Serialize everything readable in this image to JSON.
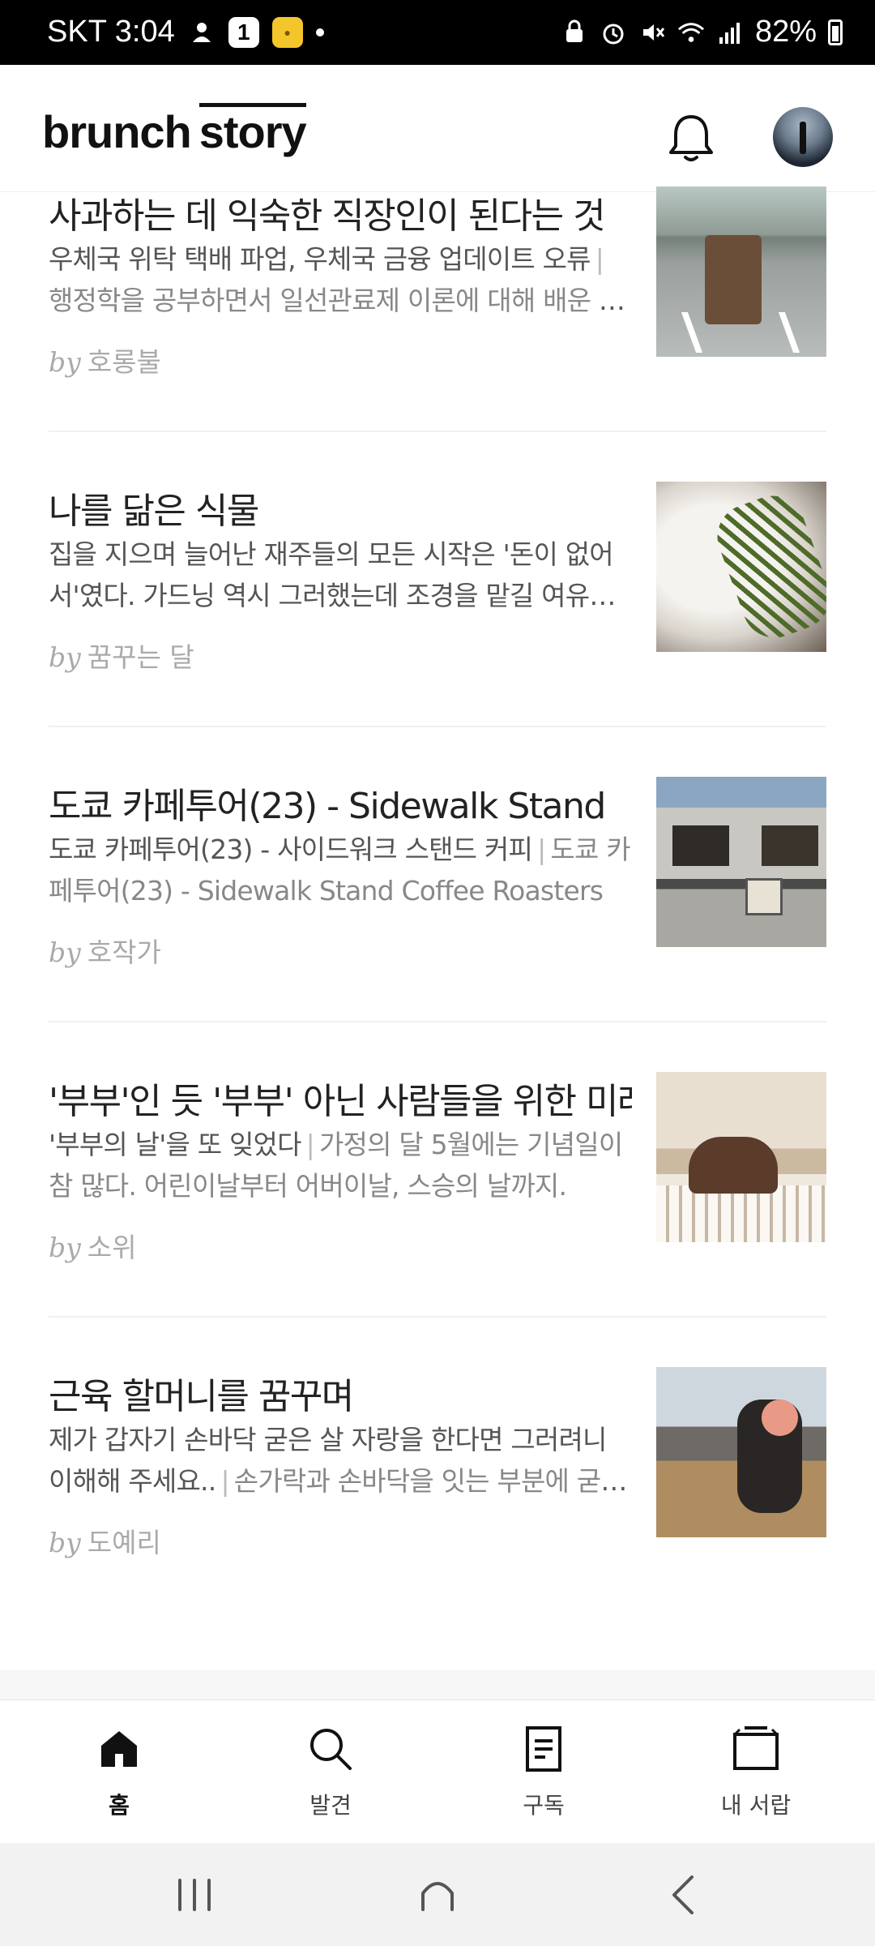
{
  "status_bar": {
    "carrier_time": "SKT 3:04",
    "badge_number": "1",
    "battery": "82%"
  },
  "header": {
    "logo_part1": "brunch",
    "logo_part2": "story"
  },
  "articles": [
    {
      "title": "사과하는 데 익숙한 직장인이 된다는 것",
      "desc": "우체국 위탁 택배 파업, 우체국 금융 업데이트 오류",
      "subdesc": "행정학을 공부하면서 일선관료제 이론에 대해 배운 적이 있다.",
      "by": "by",
      "author": "호롱불"
    },
    {
      "title": "나를 닮은 식물",
      "desc": "집을 지으며 늘어난 재주들의 모든 시작은 '돈이 없어서'였다. 가드닝 역시 그러했는데 조경을 맡길 여유가 없었다.",
      "subdesc": "",
      "by": "by",
      "author": "꿈꾸는 달"
    },
    {
      "title": "도쿄 카페투어(23) - Sidewalk Stand",
      "desc": "도쿄 카페투어(23) - 사이드워크 스탠드 커피",
      "subdesc": "도쿄 카페투어(23) - Sidewalk Stand Coffee Roasters",
      "by": "by",
      "author": "호작가"
    },
    {
      "title": "'부부'인 듯 '부부' 아닌 사람들을 위한 미래",
      "desc": "'부부의 날'을 또 잊었다",
      "subdesc": "가정의 달 5월에는 기념일이 참 많다. 어린이날부터 어버이날, 스승의 날까지.",
      "by": "by",
      "author": "소위"
    },
    {
      "title": "근육 할머니를 꿈꾸며",
      "desc": "제가 갑자기 손바닥 굳은 살 자랑을 한다면 그러려니 이해해 주세요..",
      "subdesc": "손가락과 손바닥을 잇는 부분에 굳은살이 생겼다.",
      "by": "by",
      "author": "도예리"
    }
  ],
  "tabs": {
    "home": "홈",
    "discover": "발견",
    "subscribe": "구독",
    "library": "내 서랍"
  }
}
